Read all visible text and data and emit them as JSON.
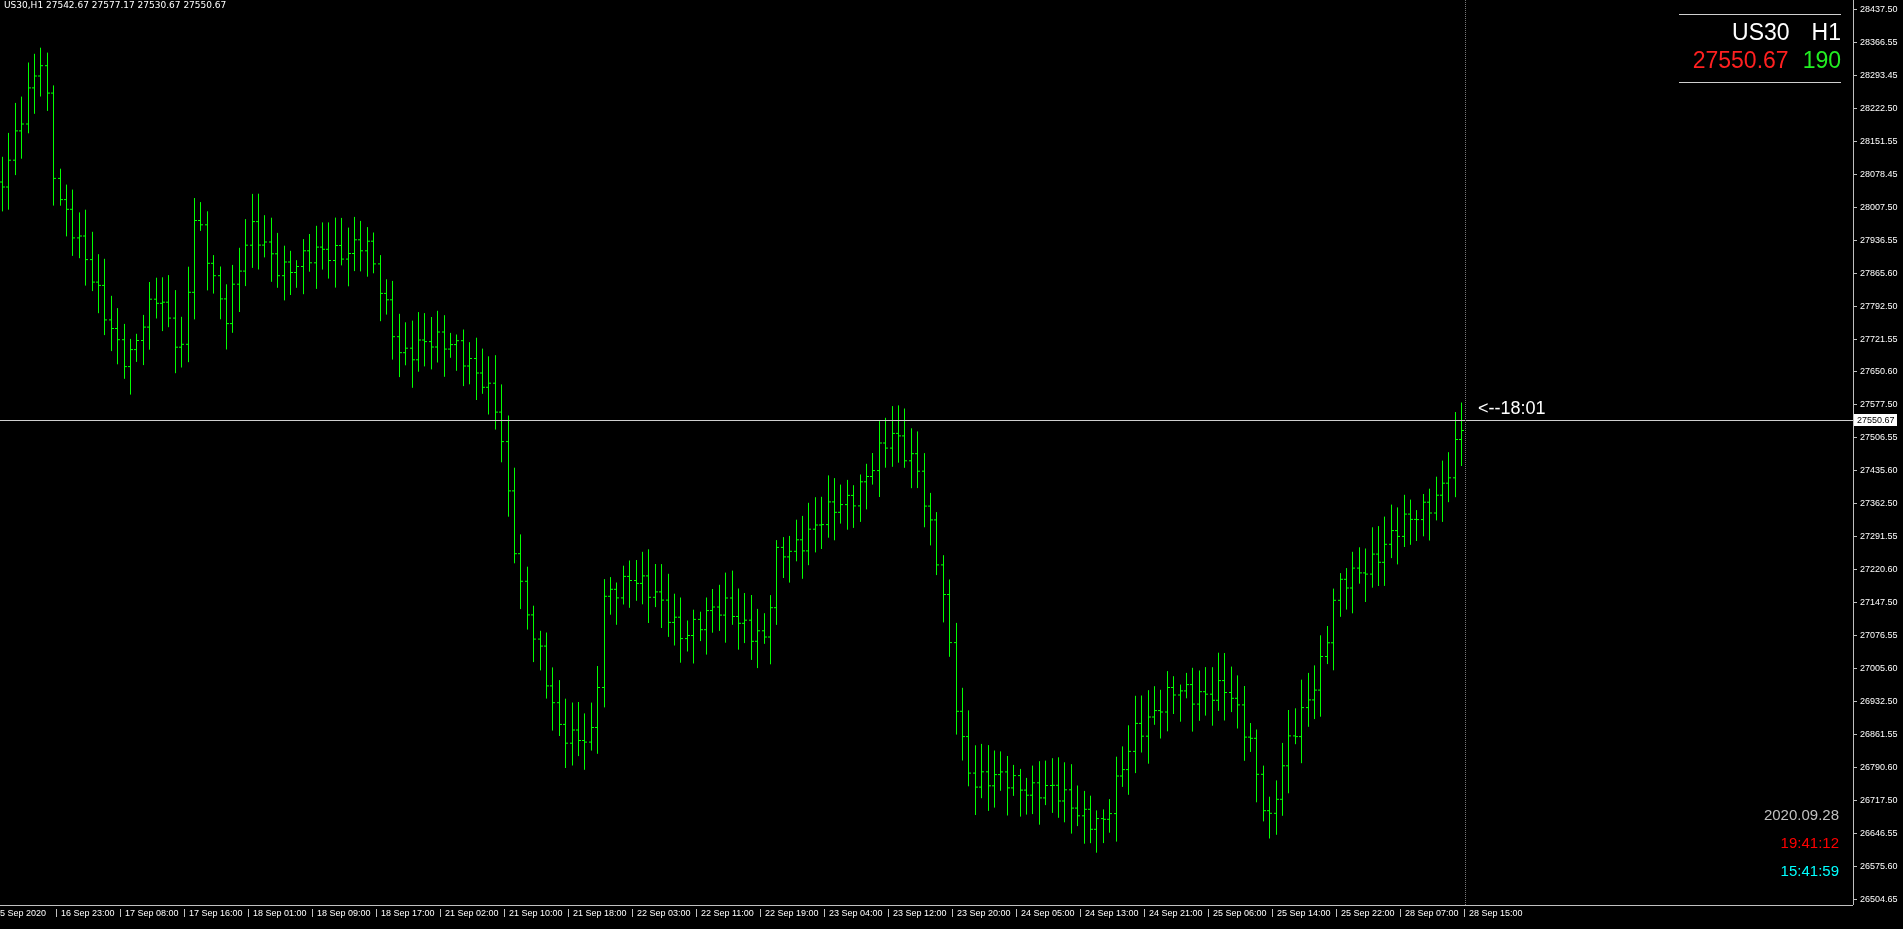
{
  "header": {
    "text": "US30,H1  27542.67 27577.17 27530.67 27550.67"
  },
  "info_box": {
    "symbol": "US30",
    "timeframe": "H1",
    "price": "27550.67",
    "spread": "190"
  },
  "price_axis": {
    "labels": [
      "28437.50",
      "28366.55",
      "28293.45",
      "28222.50",
      "28151.55",
      "28078.45",
      "28007.50",
      "27936.55",
      "27865.60",
      "27792.50",
      "27721.55",
      "27650.60",
      "27577.50",
      "27506.55",
      "27435.60",
      "27362.50",
      "27291.55",
      "27220.60",
      "27147.50",
      "27076.55",
      "27005.60",
      "26932.50",
      "26861.55",
      "26790.60",
      "26717.50",
      "26646.55",
      "26575.60",
      "26504.65"
    ],
    "current_price": "27550.67"
  },
  "cursor_label": "<--18:01",
  "clock": [
    {
      "text": "2020.09.28",
      "color": "#c0c0c0"
    },
    {
      "text": "19:41:12",
      "color": "#ff0000"
    },
    {
      "text": "15:41:59",
      "color": "#00ffff"
    }
  ],
  "time_axis": {
    "labels": [
      "5 Sep 2020",
      "16 Sep 23:00",
      "17 Sep 08:00",
      "17 Sep 16:00",
      "18 Sep 01:00",
      "18 Sep 09:00",
      "18 Sep 17:00",
      "21 Sep 02:00",
      "21 Sep 10:00",
      "21 Sep 18:00",
      "22 Sep 03:00",
      "22 Sep 11:00",
      "22 Sep 19:00",
      "23 Sep 04:00",
      "23 Sep 12:00",
      "23 Sep 20:00",
      "24 Sep 05:00",
      "24 Sep 13:00",
      "24 Sep 21:00",
      "25 Sep 06:00",
      "25 Sep 14:00",
      "25 Sep 22:00",
      "28 Sep 07:00",
      "28 Sep 15:00"
    ]
  }
}
